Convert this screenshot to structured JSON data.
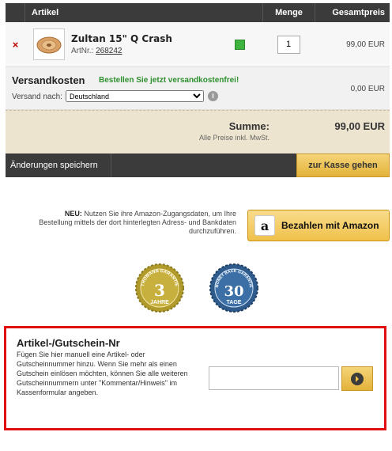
{
  "table": {
    "headers": {
      "article": "Artikel",
      "quantity": "Menge",
      "total": "Gesamtpreis"
    }
  },
  "item": {
    "remove": "×",
    "name": "Zultan 15\" Q Crash",
    "art_label": "ArtNr.:",
    "art_number": "268242",
    "quantity": "1",
    "price": "99,00 EUR",
    "stock_color": "#3fb33f"
  },
  "shipping": {
    "title": "Versandkosten",
    "promo": "Bestellen Sie jetzt versandkostenfrei!",
    "country_label": "Versand nach:",
    "country": "Deutschland",
    "info": "i",
    "price": "0,00 EUR"
  },
  "summary": {
    "label": "Summe:",
    "value": "99,00 EUR",
    "note": "Alle Preise inkl. MwSt."
  },
  "actions": {
    "save_label": "Änderungen speichern",
    "checkout_label": "zur Kasse gehen"
  },
  "amazon": {
    "new_label": "NEU:",
    "text": "Nutzen Sie ihre Amazon-Zugangsdaten, um Ihre Bestellung mittels der dort hinterlegten Adress- und Bankdaten durchzuführen.",
    "button_label": "Bezahlen mit Amazon",
    "logo_letter": "a"
  },
  "badges": {
    "guarantee": {
      "arc": "THOMANN GARANTIE",
      "number": "3",
      "unit": "JAHRE"
    },
    "money_back": {
      "arc": "MONEY BACK GARANTIE",
      "number": "30",
      "unit": "TAGE"
    }
  },
  "coupon": {
    "title": "Artikel-/Gutschein-Nr",
    "description": "Fügen Sie hier manuell eine Artikel- oder Gutscheinnummer hinzu. Wenn Sie mehr als einen Gutschein einlösen möchten, können Sie alle weiteren Gutscheinnummern unter \"Kommentar/Hinweis\" im Kassenformular angeben.",
    "value": "",
    "highlight_color": "#e01010"
  }
}
